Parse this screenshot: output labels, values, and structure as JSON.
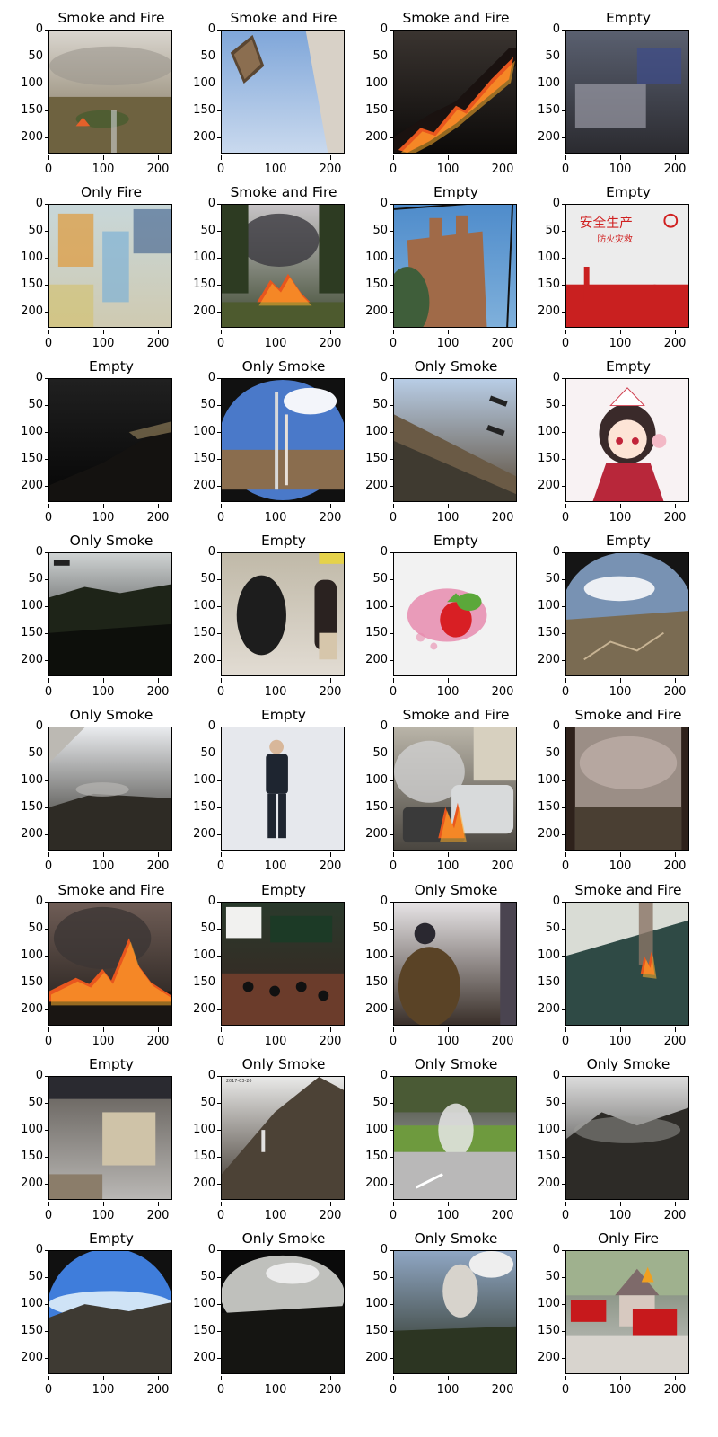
{
  "figure": {
    "x_tick_labels": [
      "0",
      "100",
      "200"
    ],
    "y_tick_labels": [
      "0",
      "50",
      "100",
      "150",
      "200"
    ],
    "panels": [
      {
        "label": "Smoke and Fire",
        "scene": "grassland-smoke-fire"
      },
      {
        "label": "Smoke and Fire",
        "scene": "building-sky"
      },
      {
        "label": "Smoke and Fire",
        "scene": "fire-line-dark"
      },
      {
        "label": "Empty",
        "scene": "indoor-blurred"
      },
      {
        "label": "Only Fire",
        "scene": "blurred-colors"
      },
      {
        "label": "Smoke and Fire",
        "scene": "forest-fire-smoke"
      },
      {
        "label": "Empty",
        "scene": "brick-building-sky"
      },
      {
        "label": "Empty",
        "scene": "red-poster-silhouettes",
        "poster_text": [
          "安全生产",
          "防火灾救"
        ]
      },
      {
        "label": "Empty",
        "scene": "night-hillside"
      },
      {
        "label": "Only Smoke",
        "scene": "tower-fisheye"
      },
      {
        "label": "Only Smoke",
        "scene": "tilted-hillside"
      },
      {
        "label": "Empty",
        "scene": "anime-character"
      },
      {
        "label": "Only Smoke",
        "scene": "dark-hills"
      },
      {
        "label": "Empty",
        "scene": "blurred-bag-bottle"
      },
      {
        "label": "Empty",
        "scene": "strawberry"
      },
      {
        "label": "Empty",
        "scene": "valley-clouds"
      },
      {
        "label": "Only Smoke",
        "scene": "fisheye-hill-smoke"
      },
      {
        "label": "Empty",
        "scene": "standing-man"
      },
      {
        "label": "Smoke and Fire",
        "scene": "car-fire"
      },
      {
        "label": "Smoke and Fire",
        "scene": "smoky-forest"
      },
      {
        "label": "Smoke and Fire",
        "scene": "forest-fire-night"
      },
      {
        "label": "Empty",
        "scene": "classroom"
      },
      {
        "label": "Only Smoke",
        "scene": "blurred-firefighter"
      },
      {
        "label": "Smoke and Fire",
        "scene": "tilted-forest-smoke"
      },
      {
        "label": "Empty",
        "scene": "office-blurred"
      },
      {
        "label": "Only Smoke",
        "scene": "grey-mountain-smoke"
      },
      {
        "label": "Only Smoke",
        "scene": "steam-ground"
      },
      {
        "label": "Only Smoke",
        "scene": "dark-mountain-fog"
      },
      {
        "label": "Empty",
        "scene": "blue-sky-mountains"
      },
      {
        "label": "Only Smoke",
        "scene": "dark-clouds-fisheye"
      },
      {
        "label": "Only Smoke",
        "scene": "smoke-plume-trees"
      },
      {
        "label": "Only Fire",
        "scene": "toy-firetrucks"
      }
    ]
  }
}
